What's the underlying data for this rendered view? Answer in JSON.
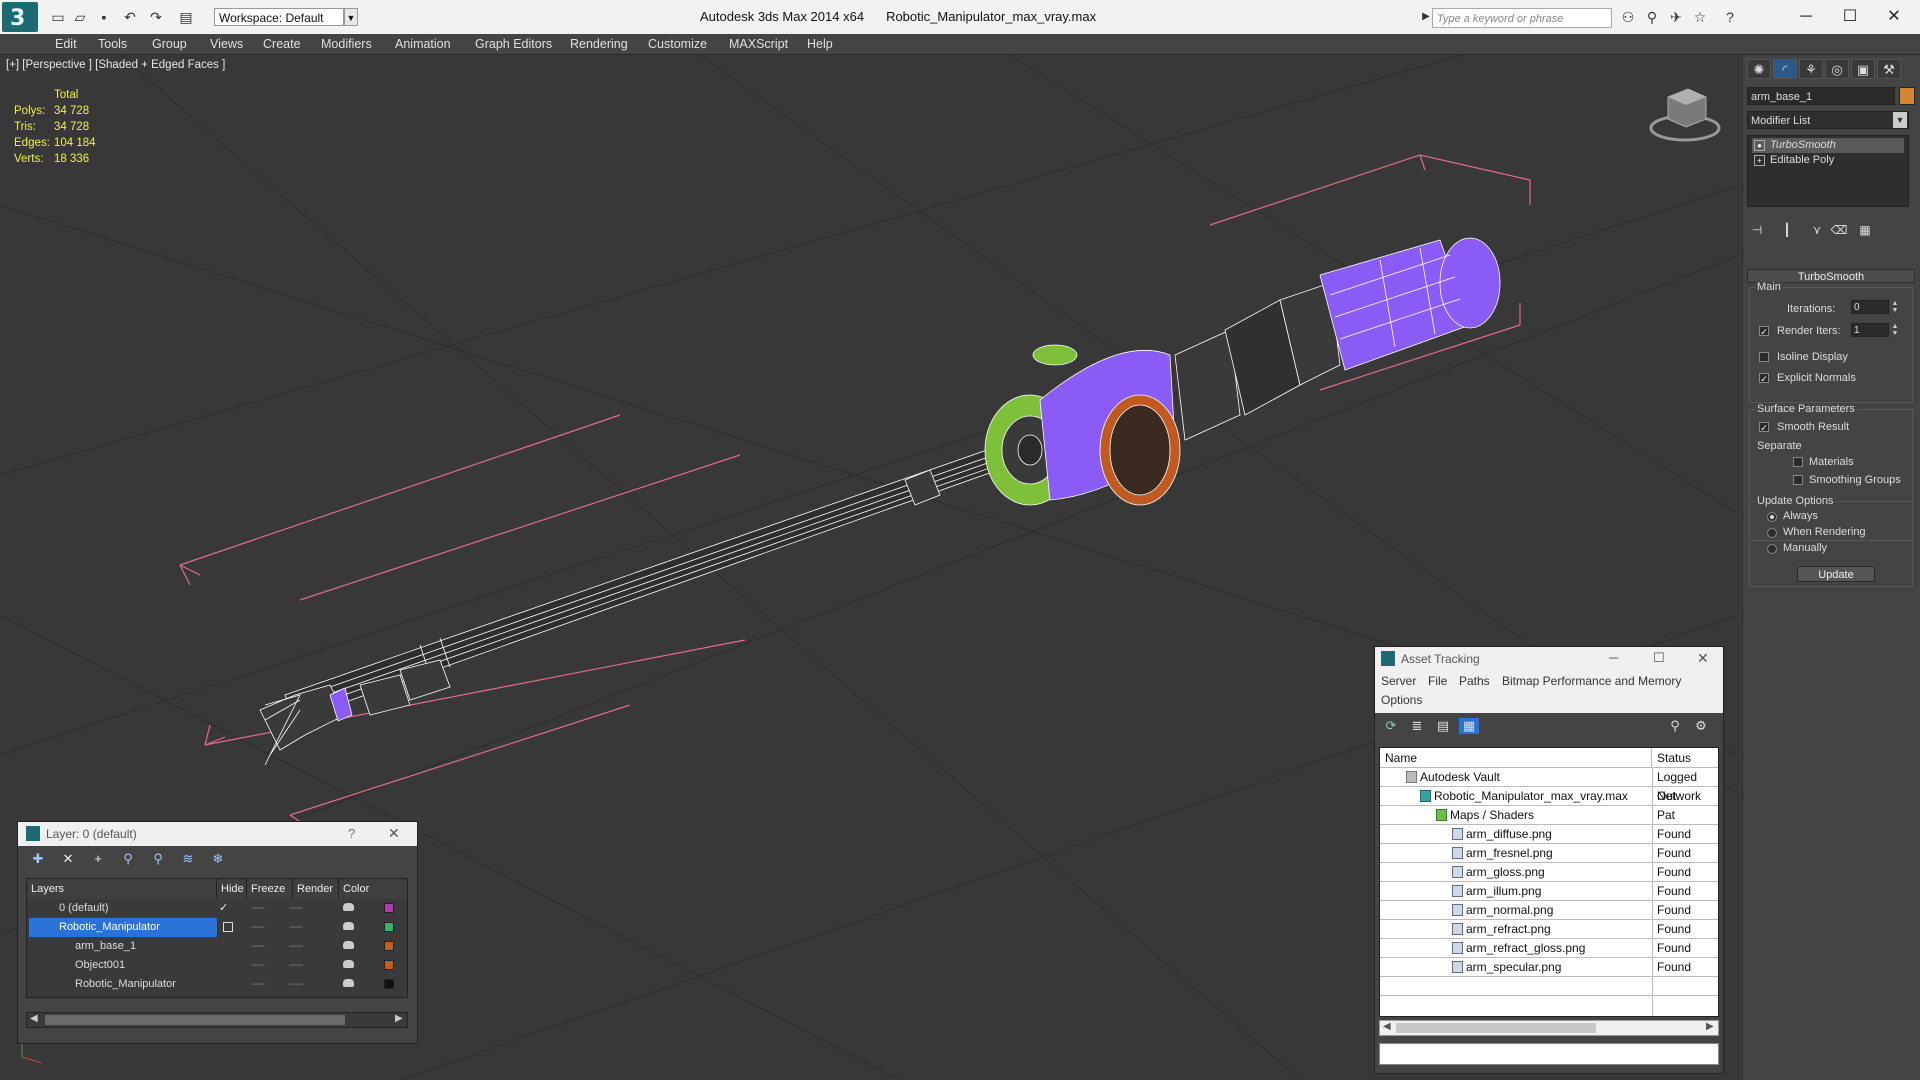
{
  "app": {
    "title": "Autodesk 3ds Max  2014 x64",
    "file": "Robotic_Manipulator_max_vray.max",
    "workspace": "Workspace: Default",
    "search_placeholder": "Type a keyword or phrase",
    "logo": "3"
  },
  "menu": [
    "Edit",
    "Tools",
    "Group",
    "Views",
    "Create",
    "Modifiers",
    "Animation",
    "Graph Editors",
    "Rendering",
    "Customize",
    "MAXScript",
    "Help"
  ],
  "viewport": {
    "label": "[+] [Perspective ] [Shaded + Edged Faces ]",
    "stats": {
      "header": "Total",
      "rows": [
        {
          "label": "Polys:",
          "value": "34 728"
        },
        {
          "label": "Tris:",
          "value": "34 728"
        },
        {
          "label": "Edges:",
          "value": "104 184"
        },
        {
          "label": "Verts:",
          "value": "18 336"
        }
      ]
    }
  },
  "command_panel": {
    "object_name": "arm_base_1",
    "object_color": "#d68530",
    "modifier_list": "Modifier List",
    "stack": [
      "TurboSmooth",
      "Editable Poly"
    ],
    "turbosmooth": {
      "title": "TurboSmooth",
      "main_label": "Main",
      "iterations_label": "Iterations:",
      "iterations_value": "0",
      "render_iters_label": "Render Iters:",
      "render_iters_value": "1",
      "isoline_label": "Isoline Display",
      "explicit_normals_label": "Explicit Normals",
      "surface_params_label": "Surface Parameters",
      "smooth_result_label": "Smooth Result",
      "separate_label": "Separate",
      "materials_label": "Materials",
      "smoothing_groups_label": "Smoothing Groups",
      "update_options_label": "Update Options",
      "always_label": "Always",
      "when_rendering_label": "When Rendering",
      "manually_label": "Manually",
      "update_button": "Update"
    }
  },
  "layer_window": {
    "title": "Layer: 0 (default)",
    "help": "?",
    "columns": [
      "Layers",
      "Hide",
      "Freeze",
      "Render",
      "Color"
    ],
    "rows": [
      {
        "name": "0 (default)",
        "color": "#b03ab0"
      },
      {
        "name": "Robotic_Manipulator",
        "color": "#3ab070"
      },
      {
        "name": "arm_base_1",
        "color": "#c06020"
      },
      {
        "name": "Object001",
        "color": "#c06020"
      },
      {
        "name": "Robotic_Manipulator",
        "color": "#111111"
      }
    ],
    "dots": "-----"
  },
  "asset_window": {
    "title": "Asset Tracking",
    "menu": [
      "Server",
      "File",
      "Paths",
      "Bitmap Performance and Memory",
      "Options"
    ],
    "columns": [
      "Name",
      "Status"
    ],
    "rows": [
      {
        "name": "Autodesk Vault",
        "status": "Logged Out"
      },
      {
        "name": "Robotic_Manipulator_max_vray.max",
        "status": "Network Pat"
      },
      {
        "name": "Maps / Shaders",
        "status": ""
      },
      {
        "name": "arm_diffuse.png",
        "status": "Found"
      },
      {
        "name": "arm_fresnel.png",
        "status": "Found"
      },
      {
        "name": "arm_gloss.png",
        "status": "Found"
      },
      {
        "name": "arm_illum.png",
        "status": "Found"
      },
      {
        "name": "arm_normal.png",
        "status": "Found"
      },
      {
        "name": "arm_refract.png",
        "status": "Found"
      },
      {
        "name": "arm_refract_gloss.png",
        "status": "Found"
      },
      {
        "name": "arm_specular.png",
        "status": "Found"
      }
    ]
  },
  "colors": {
    "wire_purple": "#8a5cf5",
    "wire_green": "#7fc03a",
    "wire_orange": "#c05a20",
    "bbox_pink": "#e26a8a",
    "selection_blue": "#2a72d8"
  }
}
